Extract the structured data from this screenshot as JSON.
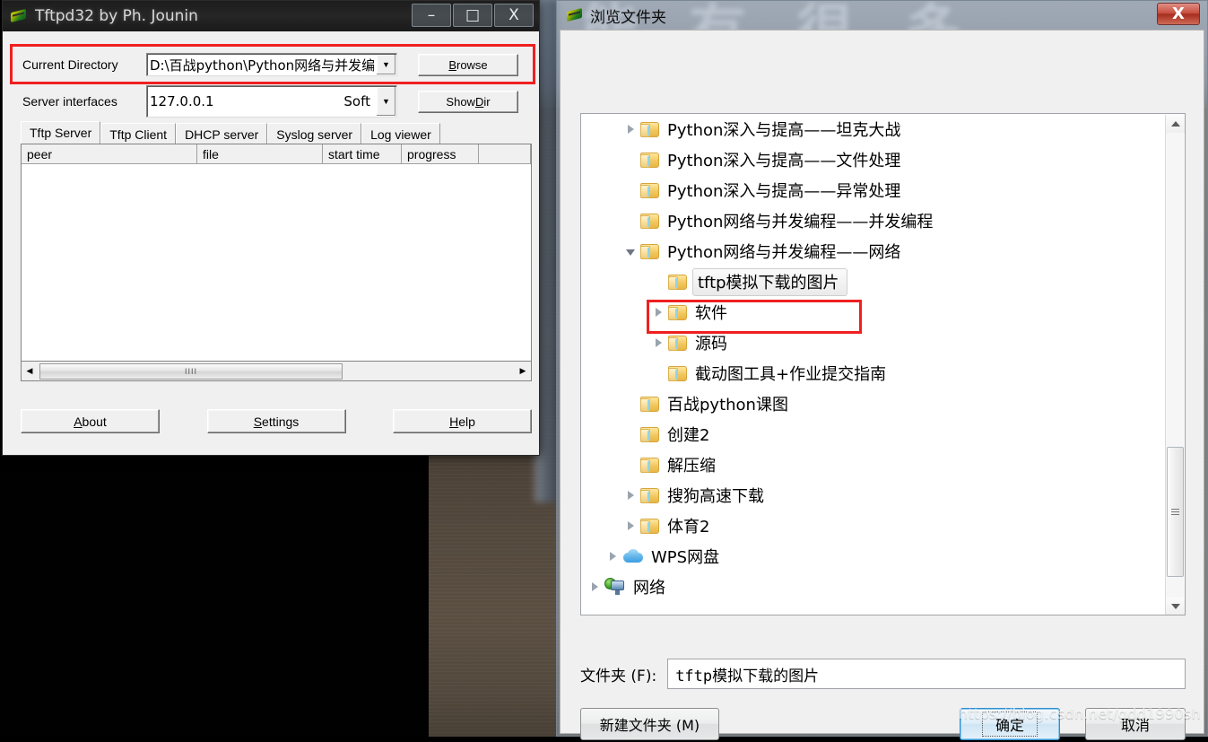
{
  "tftpd_window": {
    "title": "Tftpd32 by Ph. Jounin",
    "app_icon": "tftpd-icon",
    "window_buttons": {
      "minimize": "–",
      "maximize": "□",
      "close": "X"
    },
    "current_directory": {
      "label": "Current Directory",
      "value": "D:\\百战python\\Python网络与并发编",
      "browse_button": "Browse",
      "browse_accel": "B",
      "dropdown_icon": "chevron-down-icon",
      "highlighted": true,
      "highlight_color": "#f02020"
    },
    "server_interfaces": {
      "label": "Server interfaces",
      "value": "127.0.0.1",
      "adapter": "Soft",
      "show_dir_button": "Show Dir",
      "show_dir_accel": "D",
      "dropdown_icon": "chevron-down-icon"
    },
    "tabs": [
      {
        "label": "Tftp Server",
        "active": true
      },
      {
        "label": "Tftp Client",
        "active": false
      },
      {
        "label": "DHCP server",
        "active": false
      },
      {
        "label": "Syslog server",
        "active": false
      },
      {
        "label": "Log viewer",
        "active": false
      }
    ],
    "transfer_table": {
      "columns": [
        "peer",
        "file",
        "start time",
        "progress",
        ""
      ],
      "rows": []
    },
    "horizontal_scrollbar": {
      "left_arrow": "◀",
      "right_arrow": "▶",
      "grip": "IIII"
    },
    "footer_buttons": [
      {
        "label": "About",
        "accel": "A"
      },
      {
        "label": "Settings",
        "accel": "S"
      },
      {
        "label": "Help",
        "accel": "H"
      }
    ]
  },
  "browse_dialog": {
    "title": "浏览文件夹",
    "app_icon": "tftpd-icon",
    "close_button": "X",
    "tree": [
      {
        "label": "Python深入与提高——坦克大战",
        "icon": "folder-icon",
        "indent": 2,
        "twisty": "closed",
        "selected": false
      },
      {
        "label": "Python深入与提高——文件处理",
        "icon": "folder-icon",
        "indent": 2,
        "twisty": "none",
        "selected": false
      },
      {
        "label": "Python深入与提高——异常处理",
        "icon": "folder-icon",
        "indent": 2,
        "twisty": "none",
        "selected": false
      },
      {
        "label": "Python网络与并发编程——并发编程",
        "icon": "folder-icon",
        "indent": 2,
        "twisty": "none",
        "selected": false
      },
      {
        "label": "Python网络与并发编程——网络",
        "icon": "folder-icon",
        "indent": 2,
        "twisty": "open",
        "selected": false
      },
      {
        "label": "tftp模拟下载的图片",
        "icon": "folder-icon",
        "indent": 3,
        "twisty": "none",
        "selected": true
      },
      {
        "label": "软件",
        "icon": "folder-icon",
        "indent": 3,
        "twisty": "closed",
        "selected": false
      },
      {
        "label": "源码",
        "icon": "folder-icon",
        "indent": 3,
        "twisty": "closed",
        "selected": false
      },
      {
        "label": "截动图工具+作业提交指南",
        "icon": "folder-icon",
        "indent": 3,
        "twisty": "none",
        "selected": false
      },
      {
        "label": "百战python课图",
        "icon": "folder-icon",
        "indent": 2,
        "twisty": "none",
        "selected": false
      },
      {
        "label": "创建2",
        "icon": "folder-icon",
        "indent": 2,
        "twisty": "none",
        "selected": false
      },
      {
        "label": "解压缩",
        "icon": "folder-icon",
        "indent": 2,
        "twisty": "none",
        "selected": false
      },
      {
        "label": "搜狗高速下载",
        "icon": "folder-icon",
        "indent": 2,
        "twisty": "closed",
        "selected": false
      },
      {
        "label": "体育2",
        "icon": "folder-icon",
        "indent": 2,
        "twisty": "closed",
        "selected": false
      },
      {
        "label": "WPS网盘",
        "icon": "cloud-icon",
        "indent": 1,
        "twisty": "closed",
        "selected": false
      },
      {
        "label": "网络",
        "icon": "network-icon",
        "indent": 0,
        "twisty": "closed",
        "selected": false
      }
    ],
    "scrollbar": {
      "up_arrow": "▲",
      "down_arrow": "▼"
    },
    "folder_field": {
      "label": "文件夹 (F):",
      "value": "tftp模拟下载的图片"
    },
    "buttons": {
      "new_folder": "新建文件夹 (M)",
      "ok": "确定",
      "cancel": "取消"
    },
    "selection_highlight_color": "#f02020"
  },
  "background": {
    "ghost_text": [
      "能",
      "有",
      "很",
      "多"
    ],
    "watermark": "https://blog.csdn.net/gdd1990sh"
  }
}
